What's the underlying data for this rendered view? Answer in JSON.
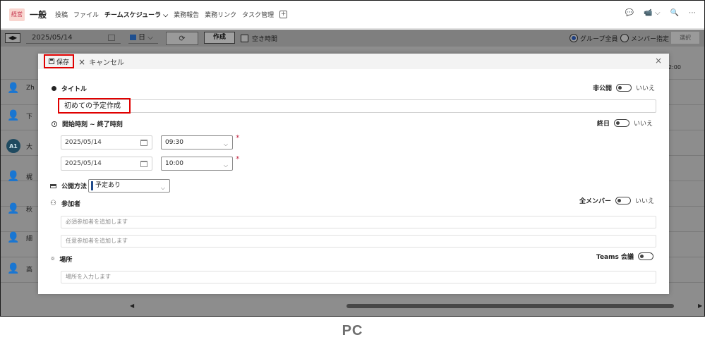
{
  "topbar": {
    "team_logo": "経営",
    "channel_name": "一般",
    "tabs": [
      {
        "label": "投稿",
        "active": false
      },
      {
        "label": "ファイル",
        "active": false
      },
      {
        "label": "チームスケジューラ ⌵",
        "active": true
      },
      {
        "label": "業務報告",
        "active": false
      },
      {
        "label": "業務リンク",
        "active": false
      },
      {
        "label": "タスク管理",
        "active": false
      }
    ],
    "add_tab": "+",
    "right_icons": [
      "chat-icon",
      "video-icon",
      "search-icon",
      "more-icon"
    ],
    "right_glyphs": [
      "💬",
      "📹 ⌵",
      "🔍",
      "⋯"
    ]
  },
  "toolbar": {
    "nav_arrows": "◀▶",
    "date": "2025/05/14",
    "view": "日",
    "view_chevron": "⌵",
    "refresh": "⟳",
    "create_label": "作成",
    "free_time_label": "空き時間",
    "radio_group_all": "グループ全員",
    "radio_member_specified": "メンバー指定",
    "select_label": "選択"
  },
  "schedule": {
    "hour_label": "2:00",
    "people": [
      {
        "name": "Zh",
        "avatar": "👤",
        "initials": ""
      },
      {
        "name": "下",
        "avatar": "👤",
        "initials": ""
      },
      {
        "name": "大",
        "avatar": "",
        "initials": "A1"
      },
      {
        "name": "梶",
        "avatar": "👤",
        "initials": ""
      },
      {
        "name": "秋",
        "avatar": "👤",
        "initials": ""
      },
      {
        "name": "細",
        "avatar": "👤",
        "initials": ""
      },
      {
        "name": "高",
        "avatar": "👤",
        "initials": ""
      }
    ],
    "scroll_left": "◀",
    "scroll_right": "▶"
  },
  "modal": {
    "save_label": "保存",
    "cancel_label": "キャンセル",
    "close": "×",
    "title_label": "タイトル",
    "private_label": "非公開",
    "private_value": "いいえ",
    "title_value": "初めての予定作成",
    "time_label": "開始時刻 ~ 終了時刻",
    "all_day_label": "終日",
    "all_day_value": "いいえ",
    "start_date": "2025/05/14",
    "start_time": "09:30",
    "end_date": "2025/05/14",
    "end_time": "10:00",
    "required_mark": "*",
    "publish_label": "公開方法",
    "publish_value": "予定あり",
    "attendees_label": "参加者",
    "all_members_label": "全メンバー",
    "all_members_value": "いいえ",
    "required_attendees_placeholder": "必須参加者を追加します",
    "optional_attendees_placeholder": "任意参加者を追加します",
    "location_label": "場所",
    "teams_meeting_label": "Teams 会議",
    "location_placeholder": "場所を入力します"
  },
  "caption": "PC",
  "colors": {
    "highlight": "#e00000",
    "accent": "#1f4a8a",
    "required": "#c4314b",
    "overlay": "#8d8d8d"
  }
}
